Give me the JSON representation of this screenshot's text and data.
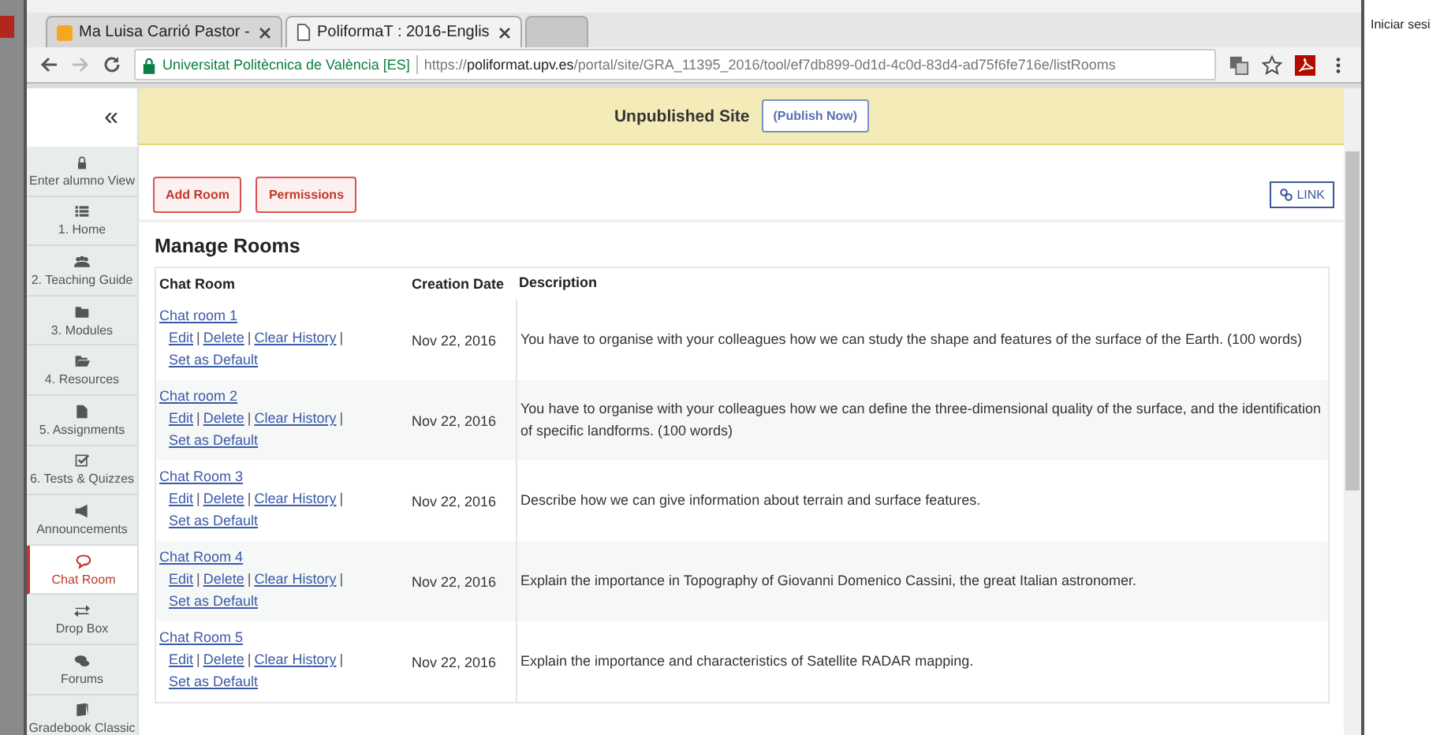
{
  "desktop": {
    "side_text": "Iniciar sesi"
  },
  "browser": {
    "tabs": [
      {
        "title": "Ma Luisa Carrió Pastor -",
        "kind": "calendar",
        "selected": false
      },
      {
        "title": "PoliformaT : 2016-Englis",
        "kind": "page",
        "selected": true
      },
      {
        "kind": "blank",
        "selected": false
      }
    ],
    "address": {
      "site_label": "Universitat Politècnica de València [ES]",
      "url_scheme": "https://",
      "url_host": "poliformat.upv.es",
      "url_path": "/portal/site/GRA_11395_2016/tool/ef7db899-0d1d-4c0d-83d4-ad75f6fe716e/listRooms"
    }
  },
  "sidebar": {
    "collapse": "«",
    "items": [
      {
        "label": "Enter alumno View",
        "selected": false
      },
      {
        "label": "1. Home",
        "selected": false
      },
      {
        "label": "2. Teaching Guide",
        "selected": false
      },
      {
        "label": "3. Modules",
        "selected": false
      },
      {
        "label": "4. Resources",
        "selected": false
      },
      {
        "label": "5. Assignments",
        "selected": false
      },
      {
        "label": "6. Tests & Quizzes",
        "selected": false
      },
      {
        "label": "Announcements",
        "selected": false
      },
      {
        "label": "Chat Room",
        "selected": true
      },
      {
        "label": "Drop Box",
        "selected": false
      },
      {
        "label": "Forums",
        "selected": false
      },
      {
        "label": "Gradebook Classic",
        "selected": false
      }
    ]
  },
  "banner": {
    "text": "Unpublished Site",
    "button": "(Publish Now)"
  },
  "toolbar": {
    "buttons": [
      "Add Room",
      "Permissions"
    ],
    "link": "LINK"
  },
  "heading": "Manage Rooms",
  "table": {
    "action_separator": "|",
    "columns": [
      "Chat Room",
      "Creation Date",
      "Description"
    ],
    "rows": [
      {
        "name": "Chat room 1",
        "actions": [
          "Edit",
          "Delete",
          "Clear History",
          "Set as Default"
        ],
        "date": "Nov 22, 2016",
        "description": "You have to organise with your colleagues how we can study the shape and features of the surface of the Earth. (100 words)"
      },
      {
        "name": "Chat room 2",
        "actions": [
          "Edit",
          "Delete",
          "Clear History",
          "Set as Default"
        ],
        "date": "Nov 22, 2016",
        "description": "You have to organise with your colleagues how we can define the three-dimensional quality of the surface, and the identification of specific landforms. (100 words)"
      },
      {
        "name": "Chat Room 3",
        "actions": [
          "Edit",
          "Delete",
          "Clear History",
          "Set as Default"
        ],
        "date": "Nov 22, 2016",
        "description": "Describe how we can give information about terrain and surface features."
      },
      {
        "name": "Chat Room 4",
        "actions": [
          "Edit",
          "Delete",
          "Clear History",
          "Set as Default"
        ],
        "date": "Nov 22, 2016",
        "description": "Explain the importance in Topography of Giovanni Domenico Cassini, the great Italian astronomer."
      },
      {
        "name": "Chat Room 5",
        "actions": [
          "Edit",
          "Delete",
          "Clear History",
          "Set as Default"
        ],
        "date": "Nov 22, 2016",
        "description": "Explain the importance and characteristics of Satellite RADAR mapping."
      }
    ]
  }
}
